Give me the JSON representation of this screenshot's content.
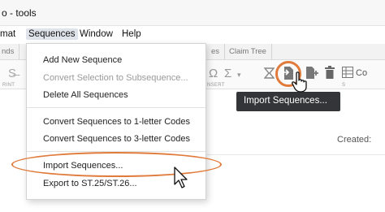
{
  "window": {
    "title": "o - tools"
  },
  "menubar": {
    "items": [
      "mat",
      "Sequences",
      "Window",
      "Help"
    ]
  },
  "tabs": [
    "nds",
    "es",
    "Claim Tree"
  ],
  "toolbar": {
    "captions": [
      "RINT",
      "NSERT",
      "S"
    ],
    "trailing_text": "Co"
  },
  "tooltip": {
    "text": "Import Sequences..."
  },
  "content": {
    "created_label": "Created:"
  },
  "sequences_menu": {
    "items": [
      {
        "label": "Add New Sequence",
        "disabled": false
      },
      {
        "label": "Convert Selection to Subsequence...",
        "disabled": true
      },
      {
        "label": "Delete All Sequences",
        "disabled": false
      },
      {
        "label": "Convert Sequences to 1-letter Codes",
        "disabled": false
      },
      {
        "label": "Convert Sequences to 3-letter Codes",
        "disabled": false
      },
      {
        "label": "Import Sequences...",
        "disabled": false
      },
      {
        "label": "Export to ST.25/ST.26...",
        "disabled": false
      }
    ]
  },
  "colors": {
    "highlight": "#e07b3c",
    "tooltip_bg": "#333538",
    "active_menu_bg": "#dfe3ea"
  },
  "icons": [
    "strikethrough-icon",
    "omega-icon",
    "sum-icon",
    "chevron-down-icon",
    "x-icon",
    "import-sequences-icon",
    "add-sequence-icon",
    "trash-icon",
    "table-icon",
    "pointer-cursor-icon",
    "arrow-cursor-icon"
  ]
}
